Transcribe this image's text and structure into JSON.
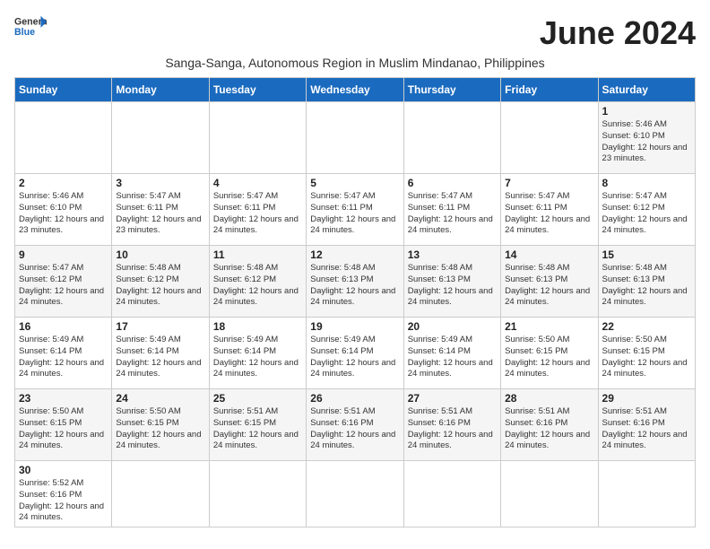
{
  "header": {
    "logo_general": "General",
    "logo_blue": "Blue",
    "month_title": "June 2024",
    "subtitle": "Sanga-Sanga, Autonomous Region in Muslim Mindanao, Philippines"
  },
  "weekdays": [
    "Sunday",
    "Monday",
    "Tuesday",
    "Wednesday",
    "Thursday",
    "Friday",
    "Saturday"
  ],
  "weeks": [
    [
      {
        "day": "",
        "info": ""
      },
      {
        "day": "",
        "info": ""
      },
      {
        "day": "",
        "info": ""
      },
      {
        "day": "",
        "info": ""
      },
      {
        "day": "",
        "info": ""
      },
      {
        "day": "",
        "info": ""
      },
      {
        "day": "1",
        "info": "Sunrise: 5:46 AM\nSunset: 6:10 PM\nDaylight: 12 hours\nand 23 minutes."
      }
    ],
    [
      {
        "day": "2",
        "info": "Sunrise: 5:46 AM\nSunset: 6:10 PM\nDaylight: 12 hours\nand 23 minutes."
      },
      {
        "day": "3",
        "info": "Sunrise: 5:47 AM\nSunset: 6:11 PM\nDaylight: 12 hours\nand 23 minutes."
      },
      {
        "day": "4",
        "info": "Sunrise: 5:47 AM\nSunset: 6:11 PM\nDaylight: 12 hours\nand 24 minutes."
      },
      {
        "day": "5",
        "info": "Sunrise: 5:47 AM\nSunset: 6:11 PM\nDaylight: 12 hours\nand 24 minutes."
      },
      {
        "day": "6",
        "info": "Sunrise: 5:47 AM\nSunset: 6:11 PM\nDaylight: 12 hours\nand 24 minutes."
      },
      {
        "day": "7",
        "info": "Sunrise: 5:47 AM\nSunset: 6:11 PM\nDaylight: 12 hours\nand 24 minutes."
      },
      {
        "day": "8",
        "info": "Sunrise: 5:47 AM\nSunset: 6:12 PM\nDaylight: 12 hours\nand 24 minutes."
      }
    ],
    [
      {
        "day": "9",
        "info": "Sunrise: 5:47 AM\nSunset: 6:12 PM\nDaylight: 12 hours\nand 24 minutes."
      },
      {
        "day": "10",
        "info": "Sunrise: 5:48 AM\nSunset: 6:12 PM\nDaylight: 12 hours\nand 24 minutes."
      },
      {
        "day": "11",
        "info": "Sunrise: 5:48 AM\nSunset: 6:12 PM\nDaylight: 12 hours\nand 24 minutes."
      },
      {
        "day": "12",
        "info": "Sunrise: 5:48 AM\nSunset: 6:13 PM\nDaylight: 12 hours\nand 24 minutes."
      },
      {
        "day": "13",
        "info": "Sunrise: 5:48 AM\nSunset: 6:13 PM\nDaylight: 12 hours\nand 24 minutes."
      },
      {
        "day": "14",
        "info": "Sunrise: 5:48 AM\nSunset: 6:13 PM\nDaylight: 12 hours\nand 24 minutes."
      },
      {
        "day": "15",
        "info": "Sunrise: 5:48 AM\nSunset: 6:13 PM\nDaylight: 12 hours\nand 24 minutes."
      }
    ],
    [
      {
        "day": "16",
        "info": "Sunrise: 5:49 AM\nSunset: 6:14 PM\nDaylight: 12 hours\nand 24 minutes."
      },
      {
        "day": "17",
        "info": "Sunrise: 5:49 AM\nSunset: 6:14 PM\nDaylight: 12 hours\nand 24 minutes."
      },
      {
        "day": "18",
        "info": "Sunrise: 5:49 AM\nSunset: 6:14 PM\nDaylight: 12 hours\nand 24 minutes."
      },
      {
        "day": "19",
        "info": "Sunrise: 5:49 AM\nSunset: 6:14 PM\nDaylight: 12 hours\nand 24 minutes."
      },
      {
        "day": "20",
        "info": "Sunrise: 5:49 AM\nSunset: 6:14 PM\nDaylight: 12 hours\nand 24 minutes."
      },
      {
        "day": "21",
        "info": "Sunrise: 5:50 AM\nSunset: 6:15 PM\nDaylight: 12 hours\nand 24 minutes."
      },
      {
        "day": "22",
        "info": "Sunrise: 5:50 AM\nSunset: 6:15 PM\nDaylight: 12 hours\nand 24 minutes."
      }
    ],
    [
      {
        "day": "23",
        "info": "Sunrise: 5:50 AM\nSunset: 6:15 PM\nDaylight: 12 hours\nand 24 minutes."
      },
      {
        "day": "24",
        "info": "Sunrise: 5:50 AM\nSunset: 6:15 PM\nDaylight: 12 hours\nand 24 minutes."
      },
      {
        "day": "25",
        "info": "Sunrise: 5:51 AM\nSunset: 6:15 PM\nDaylight: 12 hours\nand 24 minutes."
      },
      {
        "day": "26",
        "info": "Sunrise: 5:51 AM\nSunset: 6:16 PM\nDaylight: 12 hours\nand 24 minutes."
      },
      {
        "day": "27",
        "info": "Sunrise: 5:51 AM\nSunset: 6:16 PM\nDaylight: 12 hours\nand 24 minutes."
      },
      {
        "day": "28",
        "info": "Sunrise: 5:51 AM\nSunset: 6:16 PM\nDaylight: 12 hours\nand 24 minutes."
      },
      {
        "day": "29",
        "info": "Sunrise: 5:51 AM\nSunset: 6:16 PM\nDaylight: 12 hours\nand 24 minutes."
      }
    ],
    [
      {
        "day": "30",
        "info": "Sunrise: 5:52 AM\nSunset: 6:16 PM\nDaylight: 12 hours\nand 24 minutes."
      },
      {
        "day": "",
        "info": ""
      },
      {
        "day": "",
        "info": ""
      },
      {
        "day": "",
        "info": ""
      },
      {
        "day": "",
        "info": ""
      },
      {
        "day": "",
        "info": ""
      },
      {
        "day": "",
        "info": ""
      }
    ]
  ]
}
